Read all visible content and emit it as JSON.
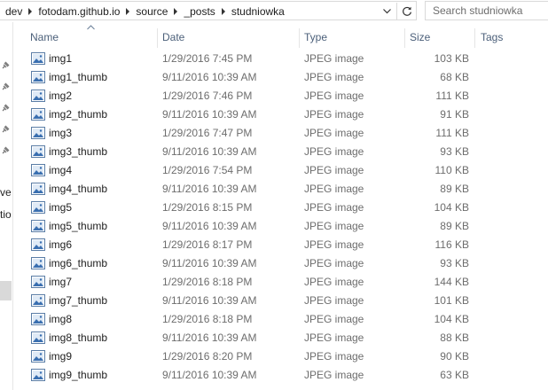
{
  "address_bar": {
    "breadcrumbs": [
      "dev",
      "fotodam.github.io",
      "source",
      "_posts",
      "studniowka"
    ]
  },
  "search": {
    "placeholder": "Search studniowka"
  },
  "nav_pane": {
    "partial_labels": [
      "ve",
      "tio"
    ]
  },
  "columns": {
    "name": "Name",
    "date": "Date",
    "type": "Type",
    "size": "Size",
    "tags": "Tags"
  },
  "files": [
    {
      "name": "img1",
      "date": "1/29/2016 7:45 PM",
      "type": "JPEG image",
      "size": "103 KB"
    },
    {
      "name": "img1_thumb",
      "date": "9/11/2016 10:39 AM",
      "type": "JPEG image",
      "size": "68 KB"
    },
    {
      "name": "img2",
      "date": "1/29/2016 7:46 PM",
      "type": "JPEG image",
      "size": "111 KB"
    },
    {
      "name": "img2_thumb",
      "date": "9/11/2016 10:39 AM",
      "type": "JPEG image",
      "size": "91 KB"
    },
    {
      "name": "img3",
      "date": "1/29/2016 7:47 PM",
      "type": "JPEG image",
      "size": "111 KB"
    },
    {
      "name": "img3_thumb",
      "date": "9/11/2016 10:39 AM",
      "type": "JPEG image",
      "size": "93 KB"
    },
    {
      "name": "img4",
      "date": "1/29/2016 7:54 PM",
      "type": "JPEG image",
      "size": "110 KB"
    },
    {
      "name": "img4_thumb",
      "date": "9/11/2016 10:39 AM",
      "type": "JPEG image",
      "size": "89 KB"
    },
    {
      "name": "img5",
      "date": "1/29/2016 8:15 PM",
      "type": "JPEG image",
      "size": "104 KB"
    },
    {
      "name": "img5_thumb",
      "date": "9/11/2016 10:39 AM",
      "type": "JPEG image",
      "size": "89 KB"
    },
    {
      "name": "img6",
      "date": "1/29/2016 8:17 PM",
      "type": "JPEG image",
      "size": "116 KB"
    },
    {
      "name": "img6_thumb",
      "date": "9/11/2016 10:39 AM",
      "type": "JPEG image",
      "size": "93 KB"
    },
    {
      "name": "img7",
      "date": "1/29/2016 8:18 PM",
      "type": "JPEG image",
      "size": "144 KB"
    },
    {
      "name": "img7_thumb",
      "date": "9/11/2016 10:39 AM",
      "type": "JPEG image",
      "size": "101 KB"
    },
    {
      "name": "img8",
      "date": "1/29/2016 8:18 PM",
      "type": "JPEG image",
      "size": "104 KB"
    },
    {
      "name": "img8_thumb",
      "date": "9/11/2016 10:39 AM",
      "type": "JPEG image",
      "size": "88 KB"
    },
    {
      "name": "img9",
      "date": "1/29/2016 8:20 PM",
      "type": "JPEG image",
      "size": "90 KB"
    },
    {
      "name": "img9_thumb",
      "date": "9/11/2016 10:39 AM",
      "type": "JPEG image",
      "size": "63 KB"
    }
  ],
  "colors": {
    "header_text": "#4c607a",
    "secondary_text": "#6d6d6d",
    "primary_text": "#1e1e1e",
    "border": "#d9d9d9"
  },
  "icons": [
    "chevron-right-icon",
    "chevron-down-icon",
    "refresh-icon",
    "pin-icon",
    "sort-up-icon",
    "image-file-icon"
  ]
}
